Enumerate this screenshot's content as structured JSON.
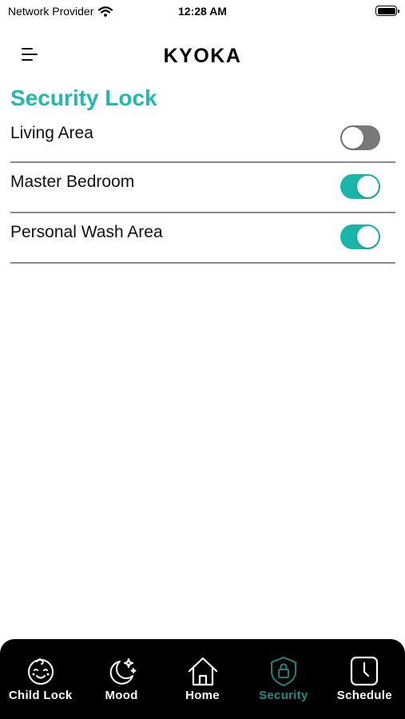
{
  "status_bar": {
    "carrier": "Network Provider",
    "wifi_icon": "wifi-icon",
    "time": "12:28 AM",
    "battery_icon": "battery-icon"
  },
  "header": {
    "menu_icon": "hamburger-menu-icon",
    "brand": "KYOKA"
  },
  "page": {
    "title": "Security Lock",
    "title_color": "#1fb8b2"
  },
  "rooms": [
    {
      "label": "Living Area",
      "enabled": false
    },
    {
      "label": "Master Bedroom",
      "enabled": true
    },
    {
      "label": "Personal Wash Area",
      "enabled": true
    }
  ],
  "toggle_colors": {
    "on": "#18b5a8",
    "off": "#787878"
  },
  "tab_bar": {
    "active": "Security",
    "active_color": "#1a8f8a",
    "tabs": [
      {
        "label": "Child Lock",
        "icon": "baby-face-icon"
      },
      {
        "label": "Mood",
        "icon": "moon-stars-icon"
      },
      {
        "label": "Home",
        "icon": "house-icon"
      },
      {
        "label": "Security",
        "icon": "shield-lock-icon"
      },
      {
        "label": "Schedule",
        "icon": "clock-icon"
      }
    ]
  }
}
